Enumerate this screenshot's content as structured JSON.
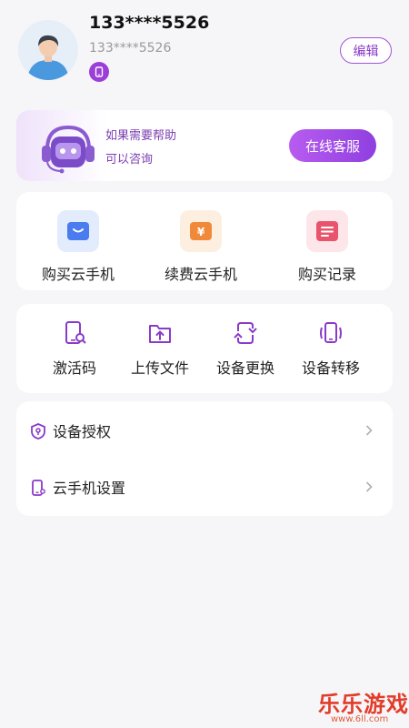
{
  "profile": {
    "phone_title": "133****5526",
    "phone_sub": "133****5526",
    "edit_label": "编辑"
  },
  "help": {
    "line1": "如果需要帮助",
    "line2": "可以咨询",
    "service_label": "在线客服"
  },
  "services": [
    {
      "label": "购买云手机",
      "icon": "shopping-bag-icon",
      "color": "#4a7cf0"
    },
    {
      "label": "续费云手机",
      "icon": "yen-icon",
      "color": "#f08a3a"
    },
    {
      "label": "购买记录",
      "icon": "record-list-icon",
      "color": "#e8546c"
    }
  ],
  "tools": [
    {
      "label": "激活码",
      "icon": "activation-code-icon"
    },
    {
      "label": "上传文件",
      "icon": "upload-folder-icon"
    },
    {
      "label": "设备更换",
      "icon": "device-swap-icon"
    },
    {
      "label": "设备转移",
      "icon": "device-transfer-icon"
    }
  ],
  "menu": [
    {
      "label": "设备授权",
      "icon": "authorization-icon"
    },
    {
      "label": "云手机设置",
      "icon": "phone-settings-icon"
    }
  ],
  "watermark": {
    "title": "乐乐游戏",
    "url": "www.6ll.com"
  },
  "colors": {
    "accent": "#9b3fd8",
    "background": "#f6f6f8"
  }
}
